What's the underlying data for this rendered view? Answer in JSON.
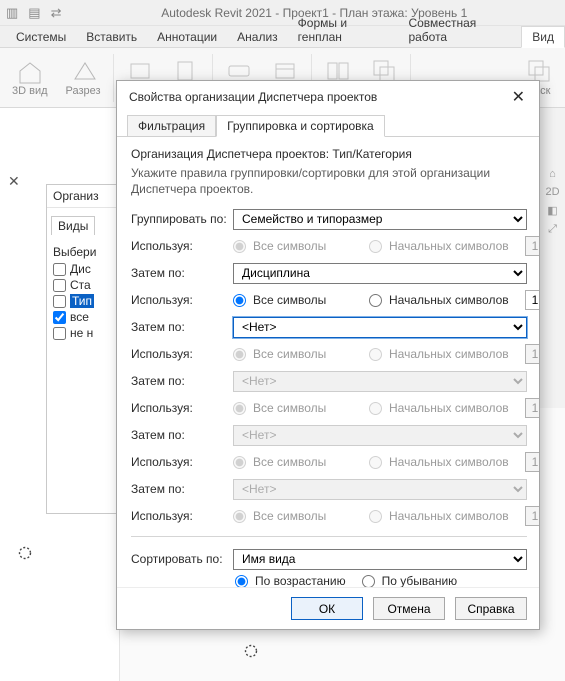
{
  "app": {
    "title": "Autodesk Revit 2021 - Проект1 - План этажа: Уровень 1"
  },
  "ribbon_tabs": [
    "Системы",
    "Вставить",
    "Аннотации",
    "Анализ",
    "Формы и генплан",
    "Совместная работа",
    "Вид"
  ],
  "ribbon_active_tab": "Вид",
  "ribbon_buttons": {
    "b0": "3D\nвид",
    "b1": "Разрез",
    "b2_last_visible": "Каск"
  },
  "bg_panel": {
    "org_label": "Организ",
    "views_tab": "Виды",
    "select_label": "Выбери",
    "check_items": [
      "Дис",
      "Ста",
      "Тип",
      "все",
      "не н"
    ],
    "checked_index": 3,
    "highlighted_index": 2
  },
  "dialog": {
    "title": "Свойства организации Диспетчера проектов",
    "tabs": {
      "filter": "Фильтрация",
      "group": "Группировка и сортировка"
    },
    "active_tab": "group",
    "intro_line1": "Организация Диспетчера проектов: Тип/Категория",
    "intro_line2": "Укажите правила группировки/сортировки для этой организации Диспетчера проектов.",
    "labels": {
      "group_by": "Группировать по:",
      "then_by": "Затем по:",
      "using": "Используя:",
      "sort_by": "Сортировать по:",
      "all_chars": "Все символы",
      "leading_chars": "Начальных символов",
      "ascending": "По возрастанию",
      "descending": "По убыванию",
      "none": "<Нет>"
    },
    "groups": [
      {
        "value": "Семейство и типоразмер",
        "all_selected": true,
        "spin": "1",
        "enabled": true,
        "using_enabled": false,
        "highlighted": false
      },
      {
        "value": "Дисциплина",
        "all_selected": true,
        "spin": "1",
        "enabled": true,
        "using_enabled": true,
        "highlighted": false
      },
      {
        "value": "<Нет>",
        "all_selected": true,
        "spin": "1",
        "enabled": true,
        "using_enabled": false,
        "highlighted": true
      },
      {
        "value": "<Нет>",
        "all_selected": true,
        "spin": "1",
        "enabled": false,
        "using_enabled": false,
        "highlighted": false
      },
      {
        "value": "<Нет>",
        "all_selected": true,
        "spin": "1",
        "enabled": false,
        "using_enabled": false,
        "highlighted": false
      },
      {
        "value": "<Нет>",
        "all_selected": true,
        "spin": "1",
        "enabled": false,
        "using_enabled": false,
        "highlighted": false
      }
    ],
    "sort": {
      "value": "Имя вида",
      "asc_selected": true
    },
    "buttons": {
      "ok": "ОК",
      "cancel": "Отмена",
      "help": "Справка"
    }
  },
  "rightstrip": {
    "item2d": "2D"
  }
}
